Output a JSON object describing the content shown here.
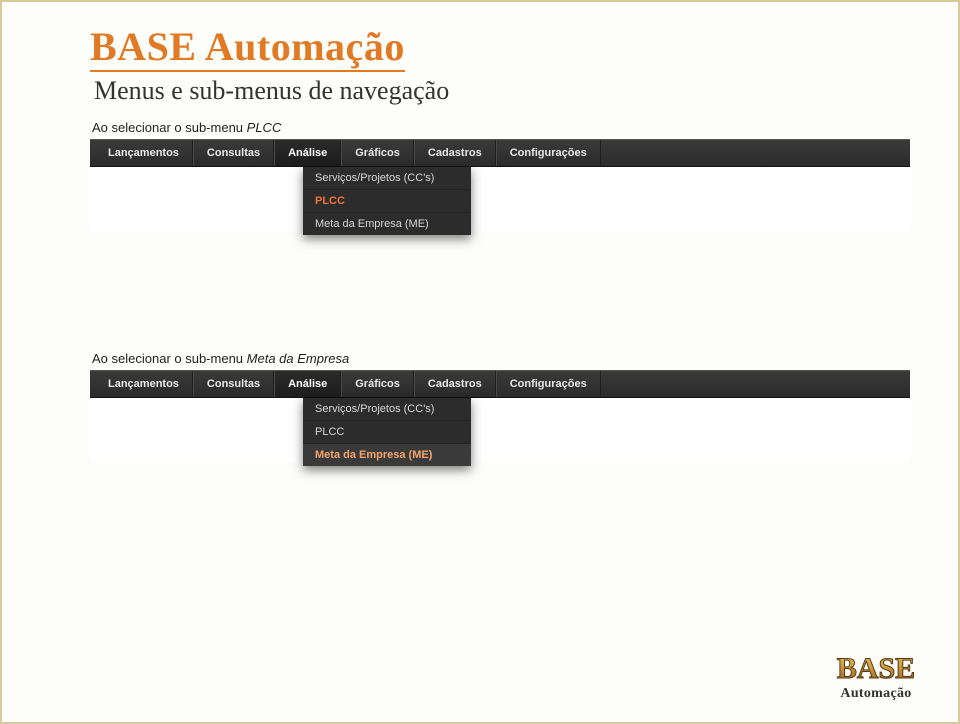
{
  "header": {
    "title": "BASE Automação",
    "subtitle": "Menus e sub-menus de navegação"
  },
  "section1": {
    "caption_prefix": "Ao selecionar o sub-menu ",
    "caption_emph": "PLCC",
    "menubar": [
      "Lançamentos",
      "Consultas",
      "Análise",
      "Gráficos",
      "Cadastros",
      "Configurações"
    ],
    "open_index": 2,
    "dropdown": [
      {
        "label": "Serviços/Projetos (CC's)",
        "state": "normal"
      },
      {
        "label": "PLCC",
        "state": "active"
      },
      {
        "label": "Meta da Empresa (ME)",
        "state": "normal"
      }
    ]
  },
  "section2": {
    "caption_prefix": "Ao selecionar o sub-menu ",
    "caption_emph": "Meta da Empresa",
    "menubar": [
      "Lançamentos",
      "Consultas",
      "Análise",
      "Gráficos",
      "Cadastros",
      "Configurações"
    ],
    "open_index": 2,
    "dropdown": [
      {
        "label": "Serviços/Projetos (CC's)",
        "state": "normal"
      },
      {
        "label": "PLCC",
        "state": "normal"
      },
      {
        "label": "Meta da Empresa (ME)",
        "state": "hover"
      }
    ]
  },
  "footer": {
    "logo_text": "BASE",
    "logo_sub": "Automação"
  }
}
